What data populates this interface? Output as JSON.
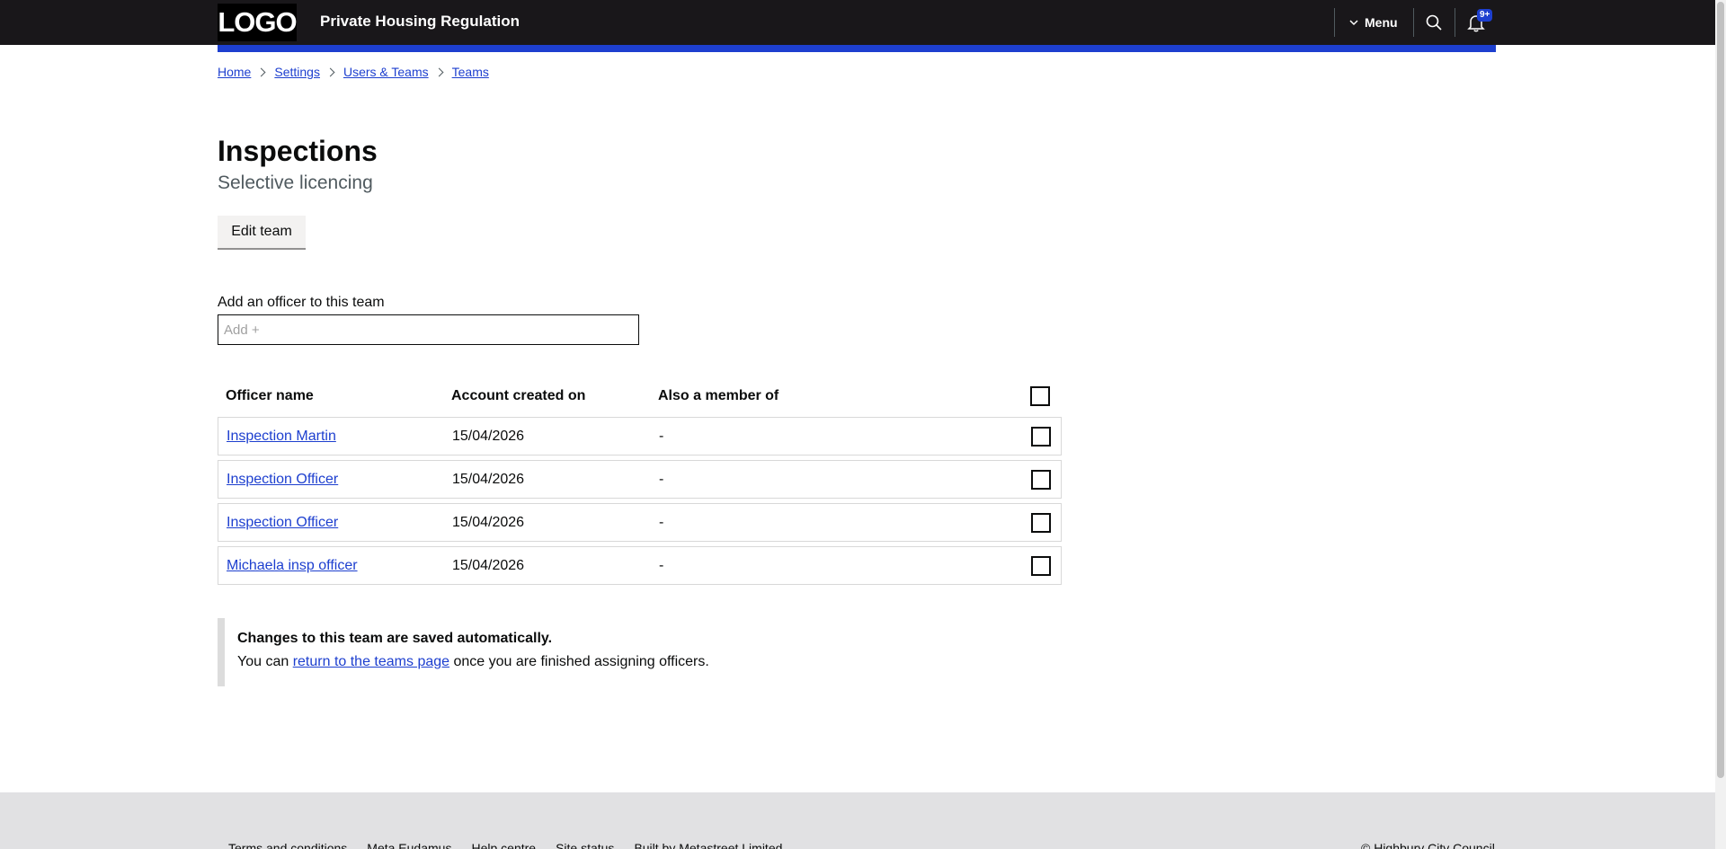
{
  "header": {
    "logo": "LOGO",
    "service_name": "Private Housing Regulation",
    "menu_label": "Menu",
    "notification_badge": "9+"
  },
  "breadcrumbs": [
    "Home",
    "Settings",
    "Users & Teams",
    "Teams"
  ],
  "page": {
    "title": "Inspections",
    "caption": "Selective licencing",
    "edit_button": "Edit team"
  },
  "add_officer": {
    "label": "Add an officer to this team",
    "placeholder": "Add +",
    "value": ""
  },
  "table": {
    "headers": {
      "name": "Officer name",
      "created": "Account created on",
      "member_of": "Also a member of"
    },
    "rows": [
      {
        "name": "Inspection Martin",
        "created": "15/04/2026",
        "member_of": "-"
      },
      {
        "name": "Inspection Officer",
        "created": "15/04/2026",
        "member_of": "-"
      },
      {
        "name": "Inspection Officer",
        "created": "15/04/2026",
        "member_of": "-"
      },
      {
        "name": "Michaela insp officer",
        "created": "15/04/2026",
        "member_of": "-"
      }
    ]
  },
  "inset": {
    "heading": "Changes to this team are saved automatically.",
    "text_before": "You can",
    "link_text": "return to the teams page",
    "text_after": "once you are finished assigning officers."
  },
  "footer": {
    "links": [
      "Terms and conditions",
      "Meta Eudamus",
      "Help centre",
      "Site status",
      "Built by Metastreet Limited"
    ],
    "copyright": "© Highbury City Council"
  },
  "colors": {
    "header_bg": "#19171a",
    "accent_blue": "#1d3fcf",
    "footer_bg": "#e1e1e3"
  }
}
